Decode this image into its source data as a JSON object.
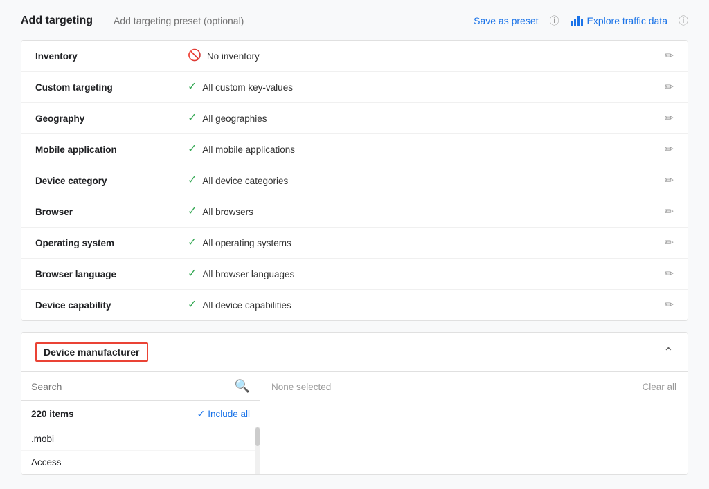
{
  "header": {
    "title": "Add targeting",
    "preset_placeholder": "Add targeting preset (optional)",
    "save_preset_label": "Save as preset",
    "explore_label": "Explore traffic data"
  },
  "targeting_rows": [
    {
      "label": "Inventory",
      "icon": "ban",
      "value": "No inventory"
    },
    {
      "label": "Custom targeting",
      "icon": "check",
      "value": "All custom key-values"
    },
    {
      "label": "Geography",
      "icon": "check",
      "value": "All geographies"
    },
    {
      "label": "Mobile application",
      "icon": "check",
      "value": "All mobile applications"
    },
    {
      "label": "Device category",
      "icon": "check",
      "value": "All device categories"
    },
    {
      "label": "Browser",
      "icon": "check",
      "value": "All browsers"
    },
    {
      "label": "Operating system",
      "icon": "check",
      "value": "All operating systems"
    },
    {
      "label": "Browser language",
      "icon": "check",
      "value": "All browser languages"
    },
    {
      "label": "Device capability",
      "icon": "check",
      "value": "All device capabilities"
    }
  ],
  "manufacturer": {
    "title": "Device manufacturer",
    "search_placeholder": "Search",
    "items_count": "220 items",
    "include_all_label": "Include all",
    "none_selected_label": "None selected",
    "clear_all_label": "Clear all",
    "list_items": [
      ".mobi",
      "Access"
    ]
  }
}
